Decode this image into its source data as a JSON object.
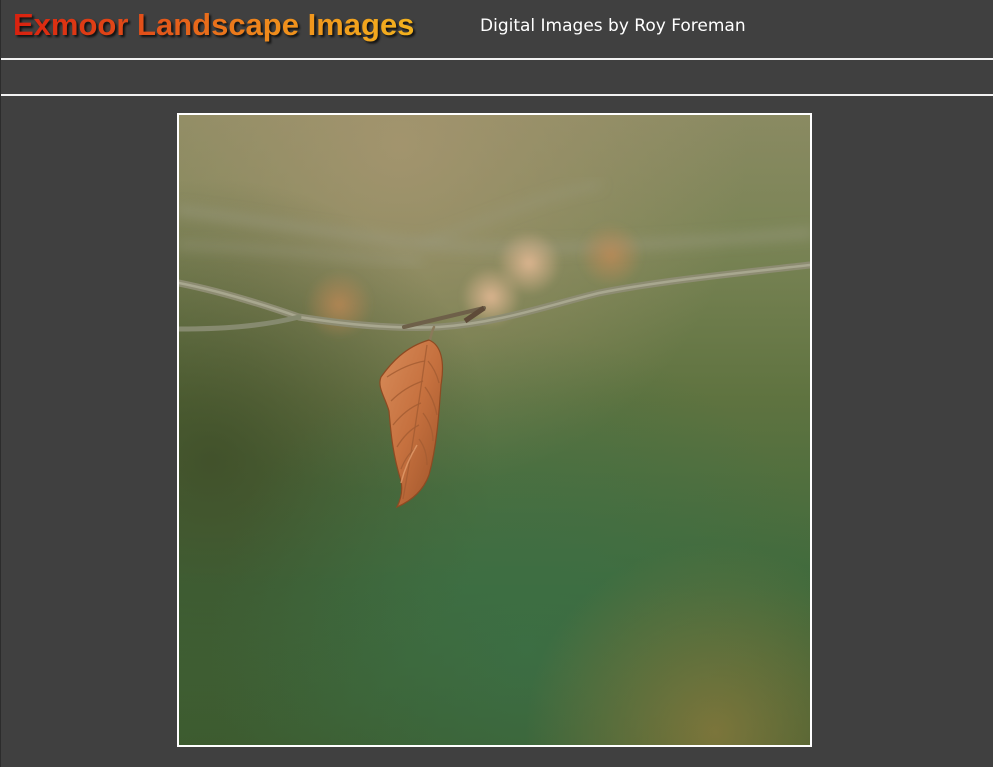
{
  "header": {
    "title": "Exmoor Landscape Images",
    "subtitle": "Digital Images by Roy Foreman"
  },
  "colors": {
    "background": "#404040",
    "rule": "#f2f2f2",
    "title_gradient_start": "#d9210f",
    "title_gradient_end": "#f3b21e",
    "subtitle": "#ffffff",
    "frame_border": "#ffffff"
  },
  "photo": {
    "subject": "dried-leaf-on-branch-photo"
  }
}
